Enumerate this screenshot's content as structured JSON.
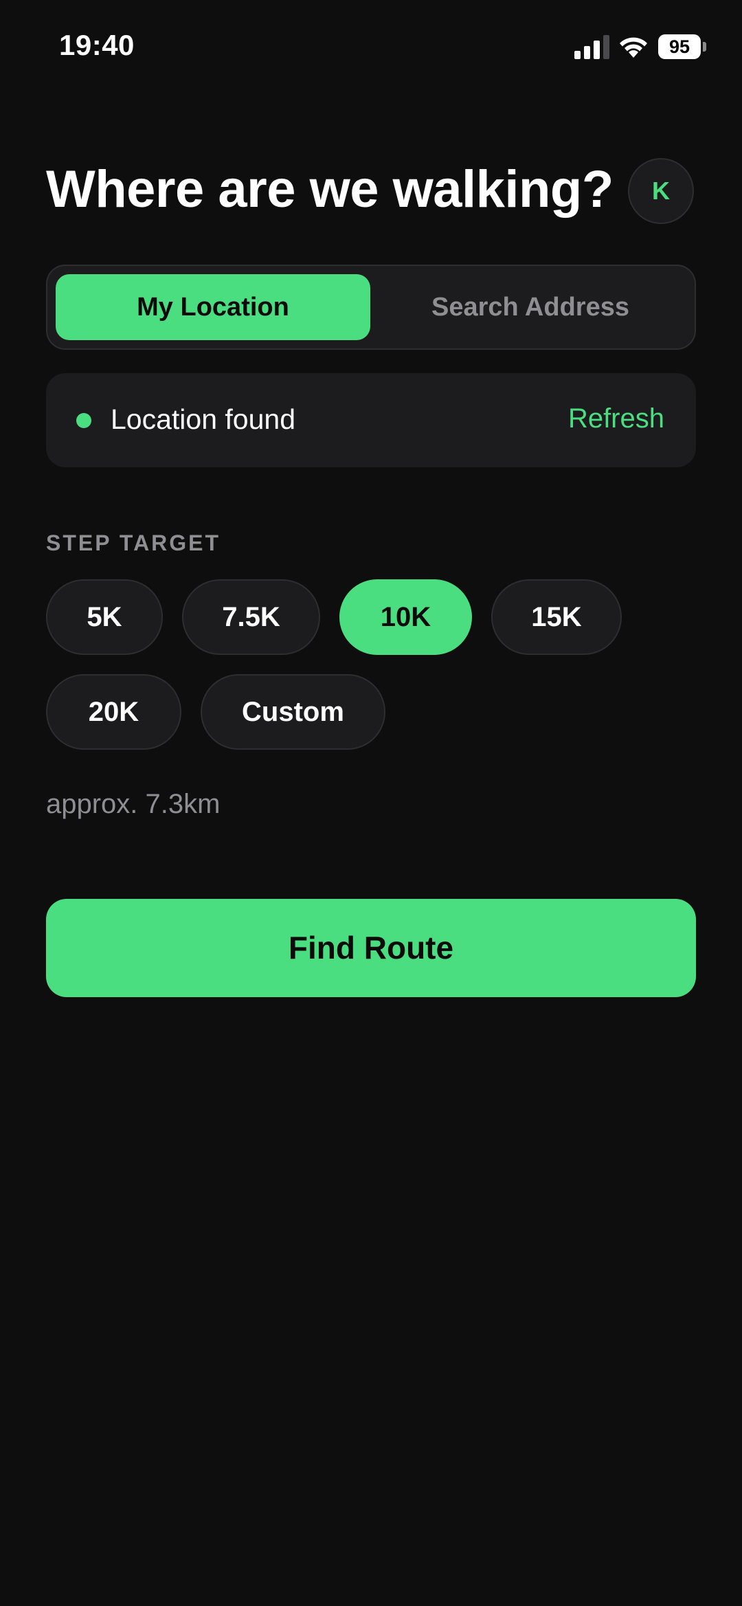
{
  "status_bar": {
    "time": "19:40",
    "battery": "95",
    "icons": [
      "signal-icon",
      "wifi-icon",
      "battery-icon"
    ]
  },
  "header": {
    "title": "Where are we walking?",
    "avatar_initial": "K"
  },
  "location_mode": {
    "options": [
      "My Location",
      "Search Address"
    ],
    "selected": "My Location"
  },
  "location_status": {
    "text": "Location found",
    "action": "Refresh"
  },
  "step_target": {
    "label": "STEP TARGET",
    "options": [
      "5K",
      "7.5K",
      "10K",
      "15K",
      "20K",
      "Custom"
    ],
    "selected": "10K",
    "approx": "approx. 7.3km"
  },
  "primary_action": {
    "label": "Find Route"
  },
  "colors": {
    "accent": "#4ade80",
    "background": "#0e0e0f",
    "surface": "#1c1c1e",
    "muted_text": "#8e8e93"
  }
}
